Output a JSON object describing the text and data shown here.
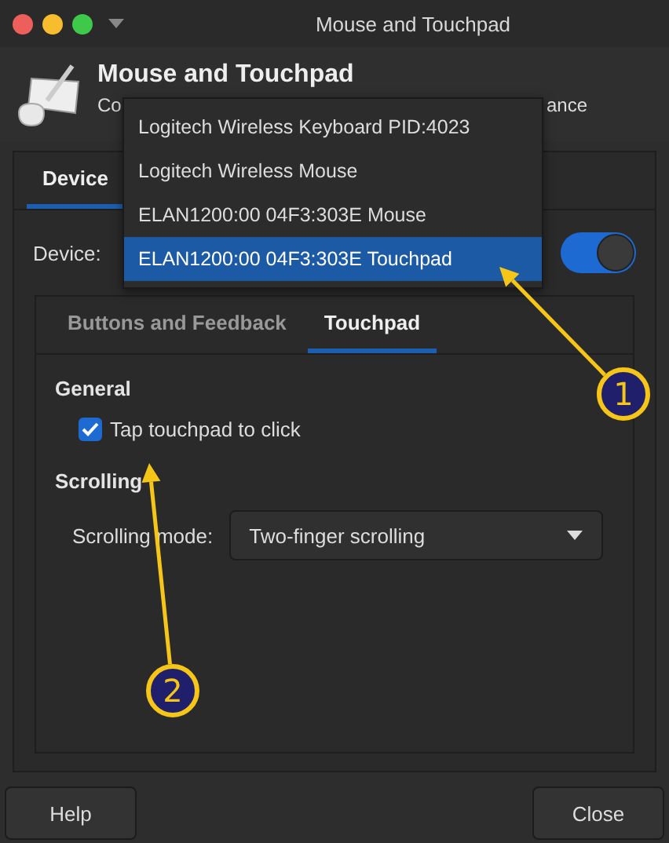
{
  "window": {
    "title": "Mouse and Touchpad"
  },
  "header": {
    "title": "Mouse and Touchpad",
    "subtitle_parts": [
      "Co",
      "ance"
    ]
  },
  "tabs": [
    {
      "label": "Device",
      "selected": true
    }
  ],
  "device": {
    "label": "Device:",
    "enabled": true
  },
  "device_menu": [
    {
      "label": "Logitech Wireless Keyboard PID:4023",
      "selected": false
    },
    {
      "label": "Logitech Wireless Mouse",
      "selected": false
    },
    {
      "label": "ELAN1200:00 04F3:303E Mouse",
      "selected": false
    },
    {
      "label": "ELAN1200:00 04F3:303E Touchpad",
      "selected": true
    }
  ],
  "subtabs": [
    {
      "label": "Buttons and Feedback",
      "selected": false
    },
    {
      "label": "Touchpad",
      "selected": true
    }
  ],
  "general": {
    "heading": "General",
    "options": [
      {
        "label": "Tap touchpad to click",
        "checked": true
      }
    ]
  },
  "scrolling": {
    "heading": "Scrolling",
    "label": "Scrolling mode:",
    "value": "Two-finger scrolling"
  },
  "buttons": [
    "Help",
    "Close"
  ],
  "annotations": [
    {
      "label": "1"
    },
    {
      "label": "2"
    }
  ]
}
